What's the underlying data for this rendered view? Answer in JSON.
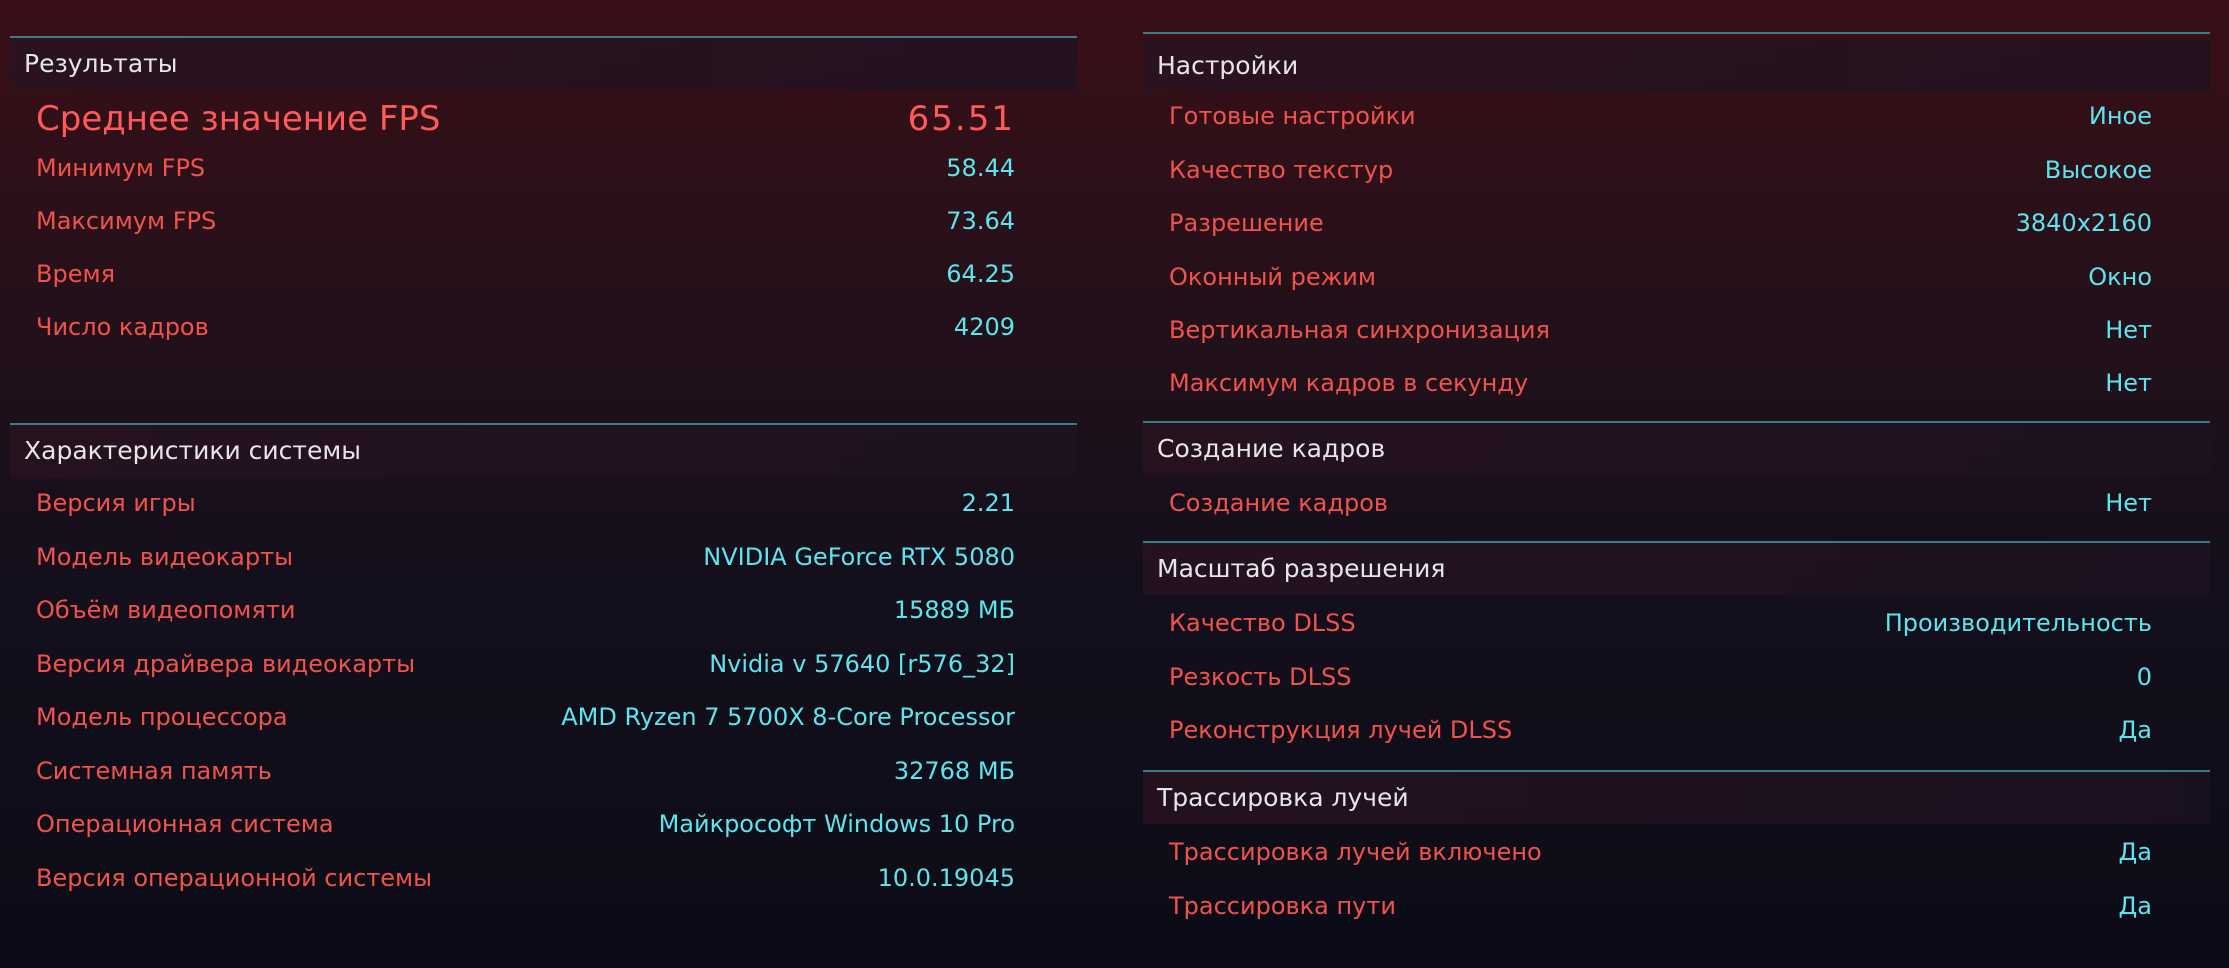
{
  "results": {
    "title": "Результаты",
    "avg_fps": {
      "label": "Среднее значение FPS",
      "value": "65.51"
    },
    "rows": [
      {
        "label": "Минимум FPS",
        "value": "58.44"
      },
      {
        "label": "Максимум FPS",
        "value": "73.64"
      },
      {
        "label": "Время",
        "value": "64.25"
      },
      {
        "label": "Число кадров",
        "value": "4209"
      }
    ]
  },
  "system": {
    "title": "Характеристики системы",
    "rows": [
      {
        "label": "Версия игры",
        "value": "2.21"
      },
      {
        "label": "Модель видеокарты",
        "value": "NVIDIA GeForce RTX 5080"
      },
      {
        "label": "Объём видеопомяти",
        "value": "15889 МБ"
      },
      {
        "label": "Версия драйвера видеокарты",
        "value": "Nvidia v 57640 [r576_32]"
      },
      {
        "label": "Модель процессора",
        "value": "AMD Ryzen 7 5700X 8-Core Processor"
      },
      {
        "label": "Системная память",
        "value": "32768 МБ"
      },
      {
        "label": "Операционная система",
        "value": "Майкрософт Windows 10 Pro"
      },
      {
        "label": "Версия операционной системы",
        "value": "10.0.19045"
      }
    ]
  },
  "settings": {
    "title": "Настройки",
    "rows": [
      {
        "label": "Готовые настройки",
        "value": "Иное"
      },
      {
        "label": "Качество текстур",
        "value": "Высокое"
      },
      {
        "label": "Разрешение",
        "value": "3840x2160"
      },
      {
        "label": "Оконный режим",
        "value": "Окно"
      },
      {
        "label": "Вертикальная синхронизация",
        "value": "Нет"
      },
      {
        "label": "Максимум кадров в секунду",
        "value": "Нет"
      }
    ]
  },
  "frame_gen": {
    "title": "Создание кадров",
    "rows": [
      {
        "label": "Создание кадров",
        "value": "Нет"
      }
    ]
  },
  "resolution_scaling": {
    "title": "Масштаб разрешения",
    "rows": [
      {
        "label": "Качество DLSS",
        "value": "Производительность"
      },
      {
        "label": "Резкость DLSS",
        "value": "0"
      },
      {
        "label": "Реконструкция лучей DLSS",
        "value": "Да"
      }
    ]
  },
  "ray_tracing": {
    "title": "Трассировка лучей",
    "rows": [
      {
        "label": "Трассировка лучей включено",
        "value": "Да"
      },
      {
        "label": "Трассировка пути",
        "value": "Да"
      }
    ]
  },
  "colors": {
    "label": "#f0534a",
    "value": "#5ee4ec",
    "title": "#e6e6ea",
    "divider": "#3f8f98"
  }
}
